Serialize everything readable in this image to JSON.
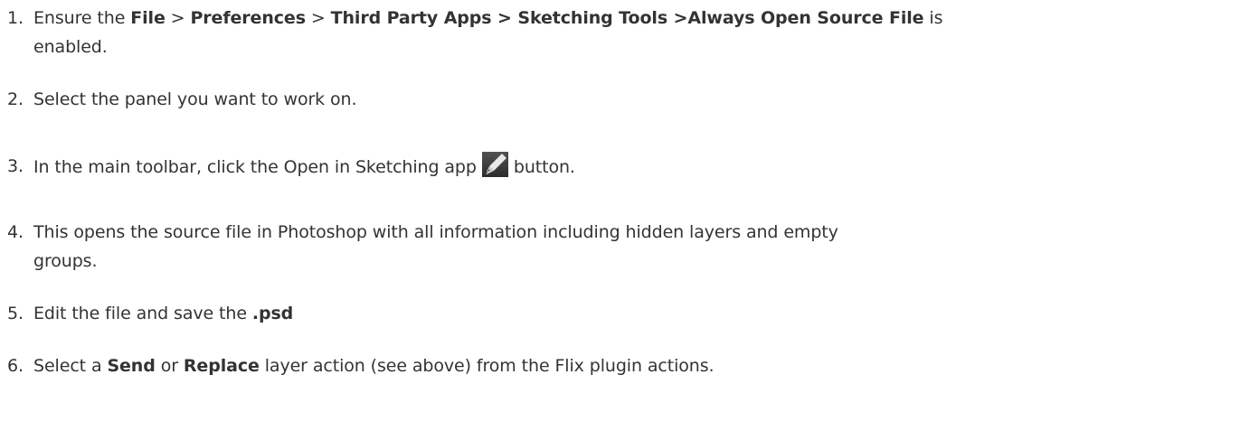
{
  "steps": [
    {
      "number": "1.",
      "prefix": "Ensure the ",
      "path": {
        "file": "File",
        "sep1": " > ",
        "preferences": "Preferences",
        "sep2": " > ",
        "third_party_apps": "Third Party Apps > Sketching Tools >Always Open Source File"
      },
      "suffix": " is",
      "continuation": "enabled."
    },
    {
      "number": "2.",
      "text": "Select the panel you want to work on."
    },
    {
      "number": "3.",
      "before_icon": "In the main toolbar, click the Open in Sketching app",
      "icon_name": "pen-nib-icon",
      "after_icon": "button."
    },
    {
      "number": "4.",
      "line1": "This opens the source file in Photoshop with all information including hidden layers and empty",
      "line2": "groups."
    },
    {
      "number": "5.",
      "prefix": "Edit the file and save the ",
      "bold": ".psd"
    },
    {
      "number": "6.",
      "prefix": "Select a ",
      "bold1": "Send",
      "middle": " or ",
      "bold2": "Replace",
      "suffix": " layer action (see above) from the Flix plugin actions."
    }
  ],
  "colors": {
    "text": "#333333",
    "icon_bg": "#3a3a3a",
    "icon_pen": "#e8e8e8"
  }
}
